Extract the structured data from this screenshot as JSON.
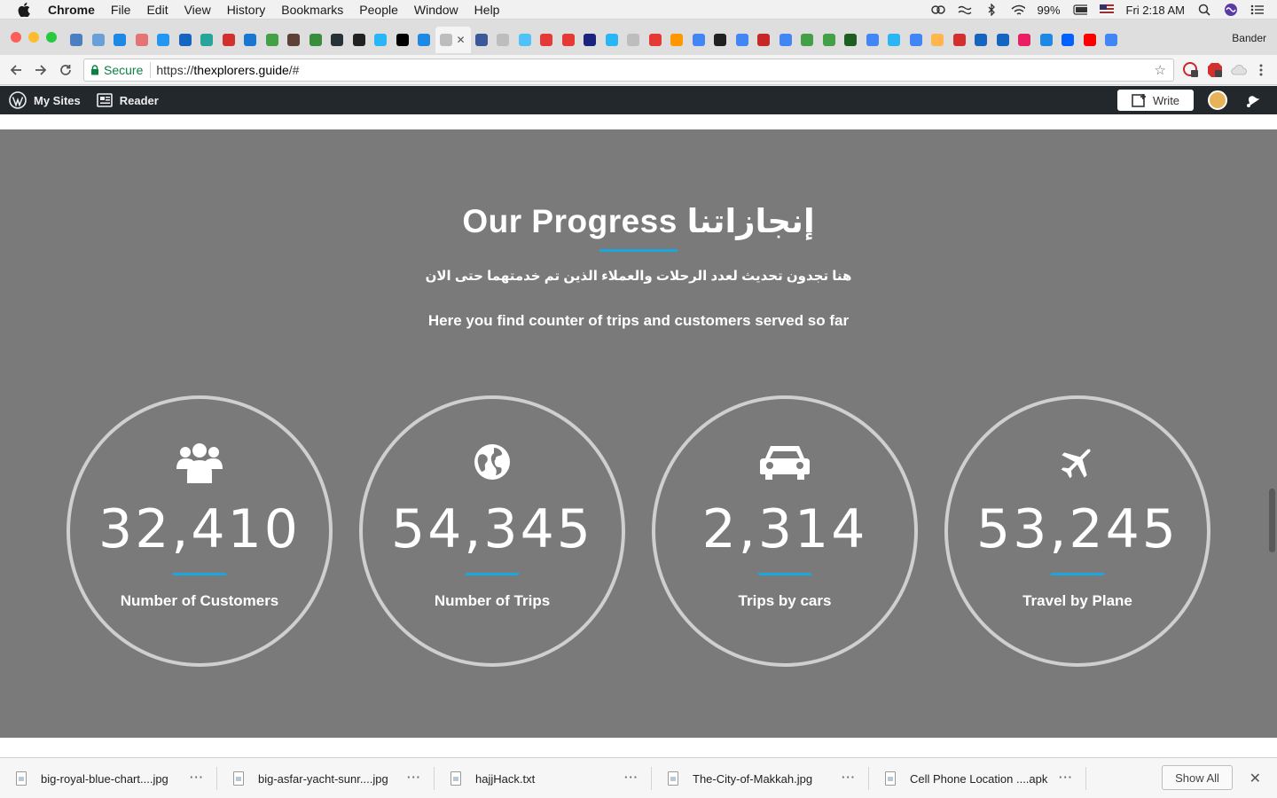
{
  "menubar": {
    "app": "Chrome",
    "items": [
      "File",
      "Edit",
      "View",
      "History",
      "Bookmarks",
      "People",
      "Window",
      "Help"
    ],
    "battery": "99%",
    "clock": "Fri 2:18 AM"
  },
  "browser": {
    "profile": "Bander",
    "secure_label": "Secure",
    "url_scheme": "https://",
    "url_host": "thexplorers.guide",
    "url_path": "/#"
  },
  "wpbar": {
    "my_sites": "My Sites",
    "reader": "Reader",
    "write": "Write"
  },
  "section": {
    "title": "Our Progress إنجازاتنا",
    "arabic_subtitle": "هنا تجدون تحديث لعدد الرحلات والعملاء الذين تم خدمتهما حتى الان",
    "english_subtitle": "Here you find counter of trips and customers served so far",
    "counters": [
      {
        "icon": "users-icon",
        "value": "32,410",
        "label": "Number of Customers"
      },
      {
        "icon": "globe-icon",
        "value": "54,345",
        "label": "Number of Trips"
      },
      {
        "icon": "car-icon",
        "value": "2,314",
        "label": "Trips by cars"
      },
      {
        "icon": "plane-icon",
        "value": "53,245",
        "label": "Travel by Plane"
      }
    ]
  },
  "downloads": {
    "items": [
      {
        "name": "big-royal-blue-chart....jpg"
      },
      {
        "name": "big-asfar-yacht-sunr....jpg"
      },
      {
        "name": "hajjHack.txt"
      },
      {
        "name": "The-City-of-Makkah.jpg"
      },
      {
        "name": "Cell Phone Location ....apk"
      }
    ],
    "show_all": "Show All"
  },
  "colors": {
    "section_bg": "#7a7a7a",
    "accent": "#19a7e0",
    "circle_border": "#cfcfcf",
    "wpbar_bg": "#23282d"
  }
}
